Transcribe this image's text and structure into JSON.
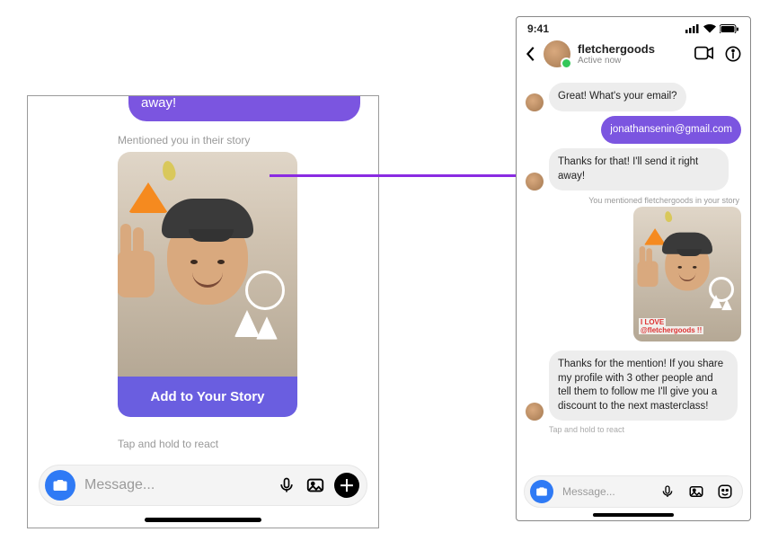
{
  "left": {
    "top_bubble_tail": "away!",
    "mention_meta": "Mentioned you in their story",
    "add_to_story": "Add to Your Story",
    "react_hint": "Tap and hold to react",
    "compose_placeholder": "Message..."
  },
  "right": {
    "status_time": "9:41",
    "header_name": "fletchergoods",
    "header_status": "Active now",
    "msg1": "Great! What's your email?",
    "msg2": "jonathansenin@gmail.com",
    "msg3": "Thanks for that! I'll send it right away!",
    "mention_meta": "You mentioned fletchergoods in your story",
    "story_tag_line1": "I LOVE",
    "story_tag_line2": "@fletchergoods !!",
    "msg4": "Thanks for the mention! If you share my profile with 3 other people and tell them to follow me I'll give you a discount to the next masterclass!",
    "react_hint": "Tap and hold to react",
    "compose_placeholder": "Message..."
  },
  "colors": {
    "accent_purple": "#7b55e0",
    "arrow": "#8a2be2",
    "camera_blue": "#2f7af5"
  }
}
